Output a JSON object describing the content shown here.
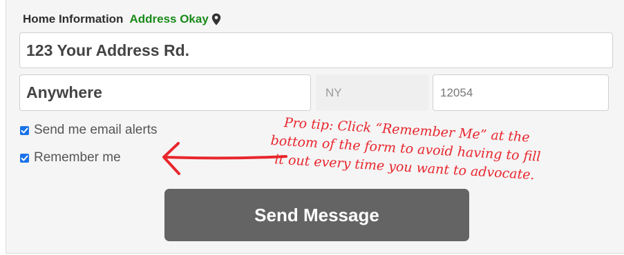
{
  "section": {
    "title": "Home Information",
    "address_status": "Address Okay",
    "status_color": "#1a8a1a",
    "status_icon": "map-pin-icon"
  },
  "form": {
    "street": "123 Your Address Rd.",
    "city": "Anywhere",
    "state": "NY",
    "zip": "12054"
  },
  "options": {
    "email_alerts_label": "Send me email alerts",
    "email_alerts_checked": true,
    "remember_me_label": "Remember me",
    "remember_me_checked": true
  },
  "actions": {
    "send_label": "Send Message",
    "button_color": "#646464"
  },
  "annotation": {
    "line1": "Pro tip: Click “Remember Me” at the",
    "line2": "bottom of the form to avoid having to fill",
    "line3": "it out every time you want to advocate.",
    "color": "#e8262d",
    "icon": "arrow-left-icon"
  }
}
